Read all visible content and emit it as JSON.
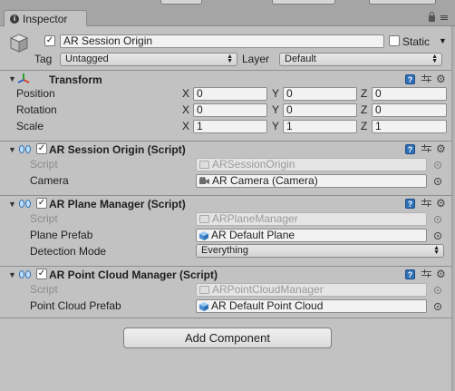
{
  "tab": {
    "label": "Inspector"
  },
  "gameobject": {
    "name": "AR Session Origin",
    "static_label": "Static",
    "tag_label": "Tag",
    "tag_value": "Untagged",
    "layer_label": "Layer",
    "layer_value": "Default"
  },
  "transform": {
    "title": "Transform",
    "rows": [
      {
        "label": "Position",
        "x": "0",
        "y": "0",
        "z": "0"
      },
      {
        "label": "Rotation",
        "x": "0",
        "y": "0",
        "z": "0"
      },
      {
        "label": "Scale",
        "x": "1",
        "y": "1",
        "z": "1"
      }
    ],
    "axis_x": "X",
    "axis_y": "Y",
    "axis_z": "Z"
  },
  "session_origin": {
    "title": "AR Session Origin (Script)",
    "script_label": "Script",
    "script_value": "ARSessionOrigin",
    "camera_label": "Camera",
    "camera_value": "AR Camera (Camera)"
  },
  "plane_manager": {
    "title": "AR Plane Manager (Script)",
    "script_label": "Script",
    "script_value": "ARPlaneManager",
    "prefab_label": "Plane Prefab",
    "prefab_value": "AR Default Plane",
    "mode_label": "Detection Mode",
    "mode_value": "Everything"
  },
  "point_cloud": {
    "title": "AR Point Cloud Manager (Script)",
    "script_label": "Script",
    "script_value": "ARPointCloudManager",
    "prefab_label": "Point Cloud Prefab",
    "prefab_value": "AR Default Point Cloud"
  },
  "add_component": {
    "label": "Add Component"
  },
  "colors": {
    "panel": "#c2c2c2",
    "help_blue": "#2f6fb6",
    "field": "#f2f2f2"
  }
}
